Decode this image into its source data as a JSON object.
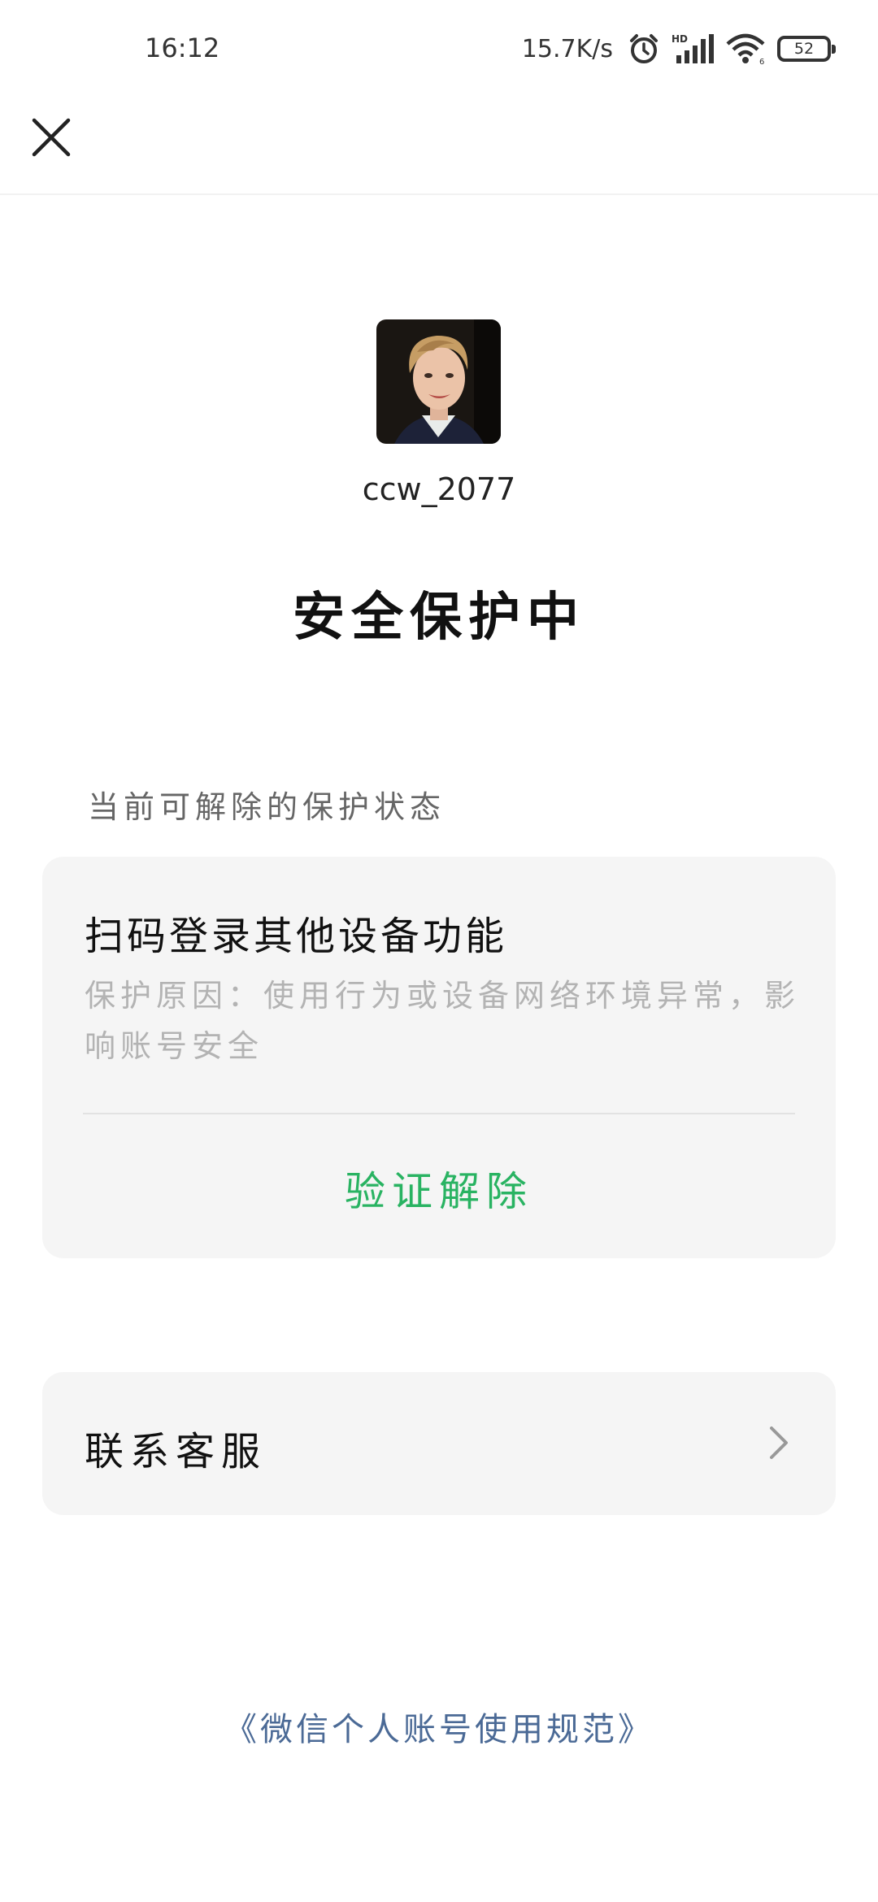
{
  "status_bar": {
    "time": "16:12",
    "net_speed": "15.7K/s",
    "battery": "52",
    "icons": [
      "alarm-icon",
      "hd-signal-icon",
      "wifi-icon",
      "battery-icon"
    ]
  },
  "nav": {
    "close_icon": "close-icon"
  },
  "profile": {
    "username": "ccw_2077",
    "title": "安全保护中"
  },
  "section": {
    "label": "当前可解除的保护状态"
  },
  "card": {
    "title": "扫码登录其他设备功能",
    "description": "保护原因：使用行为或设备网络环境异常，影响账号安全",
    "action": "验证解除",
    "action_color": "#29b362"
  },
  "contact": {
    "label": "联系客服",
    "chevron_icon": "chevron-right-icon"
  },
  "footer": {
    "link": "《微信个人账号使用规范》",
    "link_color": "#4b6a96"
  }
}
